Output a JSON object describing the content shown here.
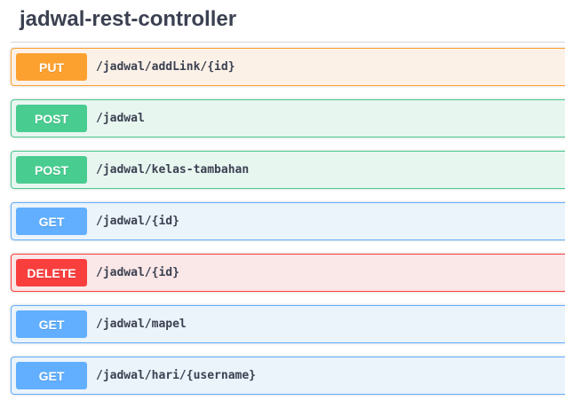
{
  "section": {
    "title": "jadwal-rest-controller"
  },
  "operations": [
    {
      "method": "PUT",
      "path": "/jadwal/addLink/{id}"
    },
    {
      "method": "POST",
      "path": "/jadwal"
    },
    {
      "method": "POST",
      "path": "/jadwal/kelas-tambahan"
    },
    {
      "method": "GET",
      "path": "/jadwal/{id}"
    },
    {
      "method": "DELETE",
      "path": "/jadwal/{id}"
    },
    {
      "method": "GET",
      "path": "/jadwal/mapel"
    },
    {
      "method": "GET",
      "path": "/jadwal/hari/{username}"
    }
  ],
  "colors": {
    "put": "#fca130",
    "post": "#49cc90",
    "get": "#61affe",
    "delete": "#f93e3e"
  }
}
